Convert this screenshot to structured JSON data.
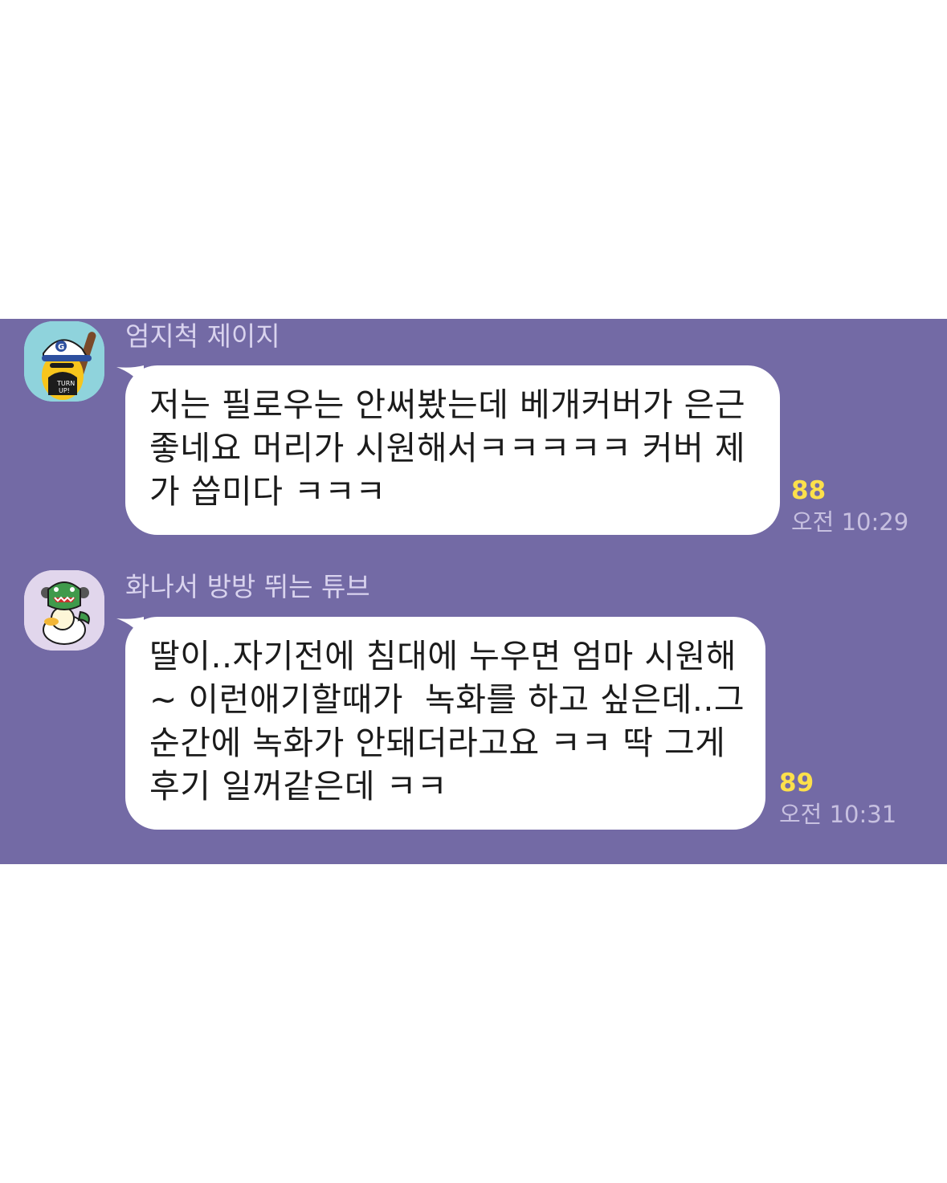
{
  "chat": {
    "background_color": "#736aa5",
    "bubble_color": "#ffffff",
    "unread_color": "#fde04b",
    "messages": [
      {
        "sender": "엄지척 제이지",
        "avatar_icon": "jay-g-thumbs-up-avatar-icon",
        "lines": [
          "저는 필로우는 안써봤는데 베개커버가 은근",
          "좋네요 머리가 시원해서ㅋㅋㅋㅋㅋ 커버 제",
          "가 씁미다 ㅋㅋㅋ"
        ],
        "unread_count": "88",
        "time": "오전 10:29"
      },
      {
        "sender": "화나서 방방 뛰는 튜브",
        "avatar_icon": "tube-angry-duck-avatar-icon",
        "lines": [
          "딸이..자기전에 침대에 누우면 엄마 시원해",
          "~ 이런애기할때가  녹화를 하고 싶은데..그",
          "순간에 녹화가 안돼더라고요 ㅋㅋ 딱 그게",
          "후기 일꺼같은데 ㅋㅋ"
        ],
        "unread_count": "89",
        "time": "오전 10:31"
      }
    ]
  }
}
